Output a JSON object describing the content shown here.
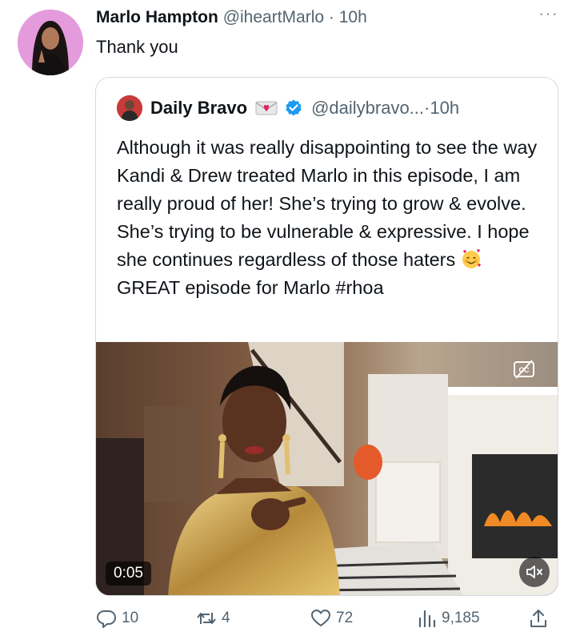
{
  "tweet": {
    "author_name": "Marlo Hampton",
    "author_handle": "@iheartMarlo",
    "separator": "·",
    "time": "10h",
    "text": "Thank you",
    "more_icon": "more-horizontal-icon"
  },
  "quoted_tweet": {
    "author_name": "Daily Bravo",
    "author_handle": "@dailybravo...",
    "separator": "·",
    "time": "10h",
    "text_before_emoji": "Although it was really disappointing to see the way Kandi & Drew treated Marlo in this episode, I am really proud of her! She’s trying to grow & evolve. She’s trying to be vulnerable & expressive. I hope she continues regardless of those haters",
    "text_after_emoji": "GREAT episode for Marlo #rhoa",
    "emoji": "smiling-face-with-hearts-emoji",
    "badges": [
      "love-letter-icon",
      "verified-badge-icon"
    ],
    "video": {
      "duration": "0:05",
      "controls": [
        "closed-captions-icon",
        "mute-icon"
      ]
    }
  },
  "actions": {
    "replies": "10",
    "retweets": "4",
    "likes": "72",
    "views": "9,185",
    "share_icon": "share-icon"
  },
  "colors": {
    "text": "#0f1419",
    "muted": "#536471",
    "verified": "#1d9bf0",
    "border": "#d6dbe0"
  }
}
